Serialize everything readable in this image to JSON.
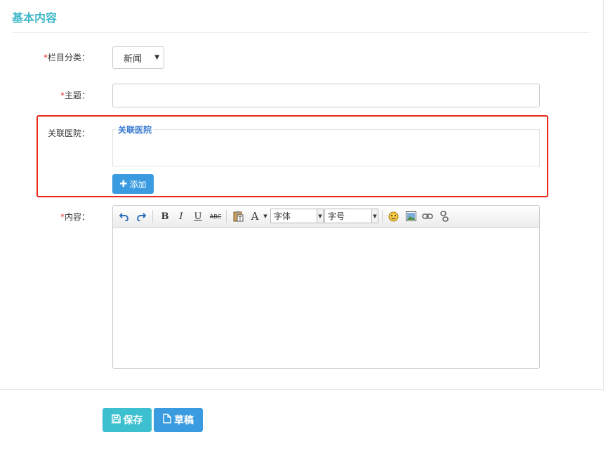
{
  "section": {
    "title": "基本内容"
  },
  "form": {
    "category": {
      "required_mark": "*",
      "label": "栏目分类：",
      "value": "新闻"
    },
    "subject": {
      "required_mark": "*",
      "label": "主题：",
      "value": ""
    },
    "hospital": {
      "label": "关联医院：",
      "legend": "关联医院",
      "add_label": "添加"
    },
    "content": {
      "required_mark": "*",
      "label": "内容："
    }
  },
  "editor": {
    "toolbar": {
      "bold": "B",
      "italic": "I",
      "underline": "U",
      "strike": "ABC",
      "font_color": "A",
      "font_family": "字体",
      "font_size": "字号"
    }
  },
  "actions": {
    "save_label": "保存",
    "draft_label": "草稿"
  },
  "colors": {
    "accent": "#3fb8c9",
    "primary": "#3a9be0",
    "highlight": "#e8291c",
    "required": "#e53935"
  }
}
